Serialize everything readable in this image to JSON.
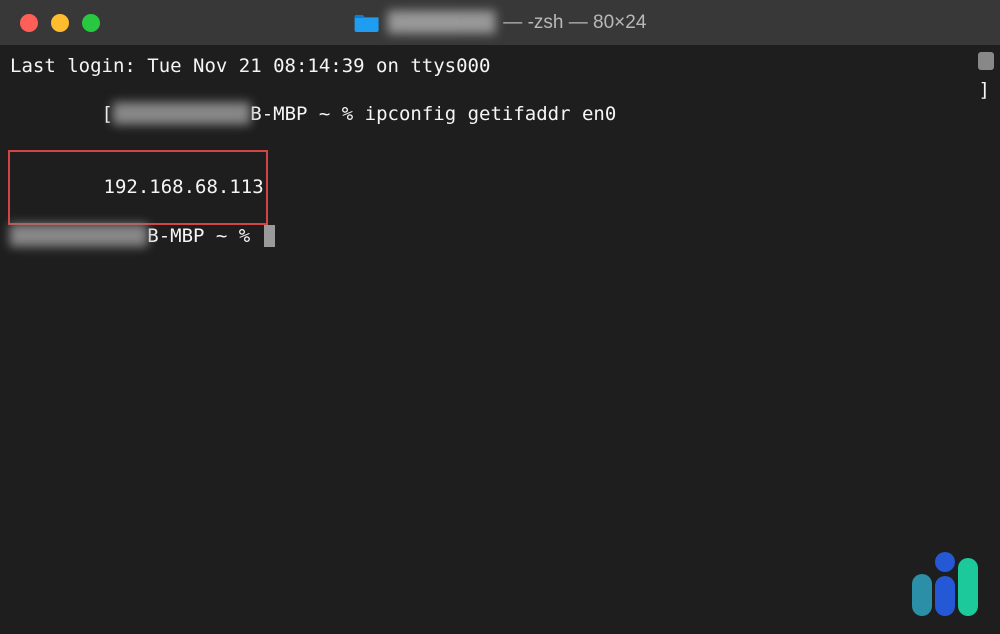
{
  "titlebar": {
    "redacted_name": "████████",
    "suffix": " — -zsh — 80×24"
  },
  "terminal": {
    "last_login": "Last login: Tue Nov 21 08:14:39 on ttys000",
    "prompt_bracket_open": "[",
    "prompt_redacted": "████████████",
    "prompt_host_suffix": "B-MBP",
    "prompt_path": " ~ % ",
    "command": "ipconfig getifaddr en0",
    "prompt_bracket_close": "]",
    "ip_output": "192.168.68.113",
    "prompt2_redacted": "████████████",
    "prompt2_host_suffix": "B-MBP",
    "prompt2_path": " ~ % "
  }
}
